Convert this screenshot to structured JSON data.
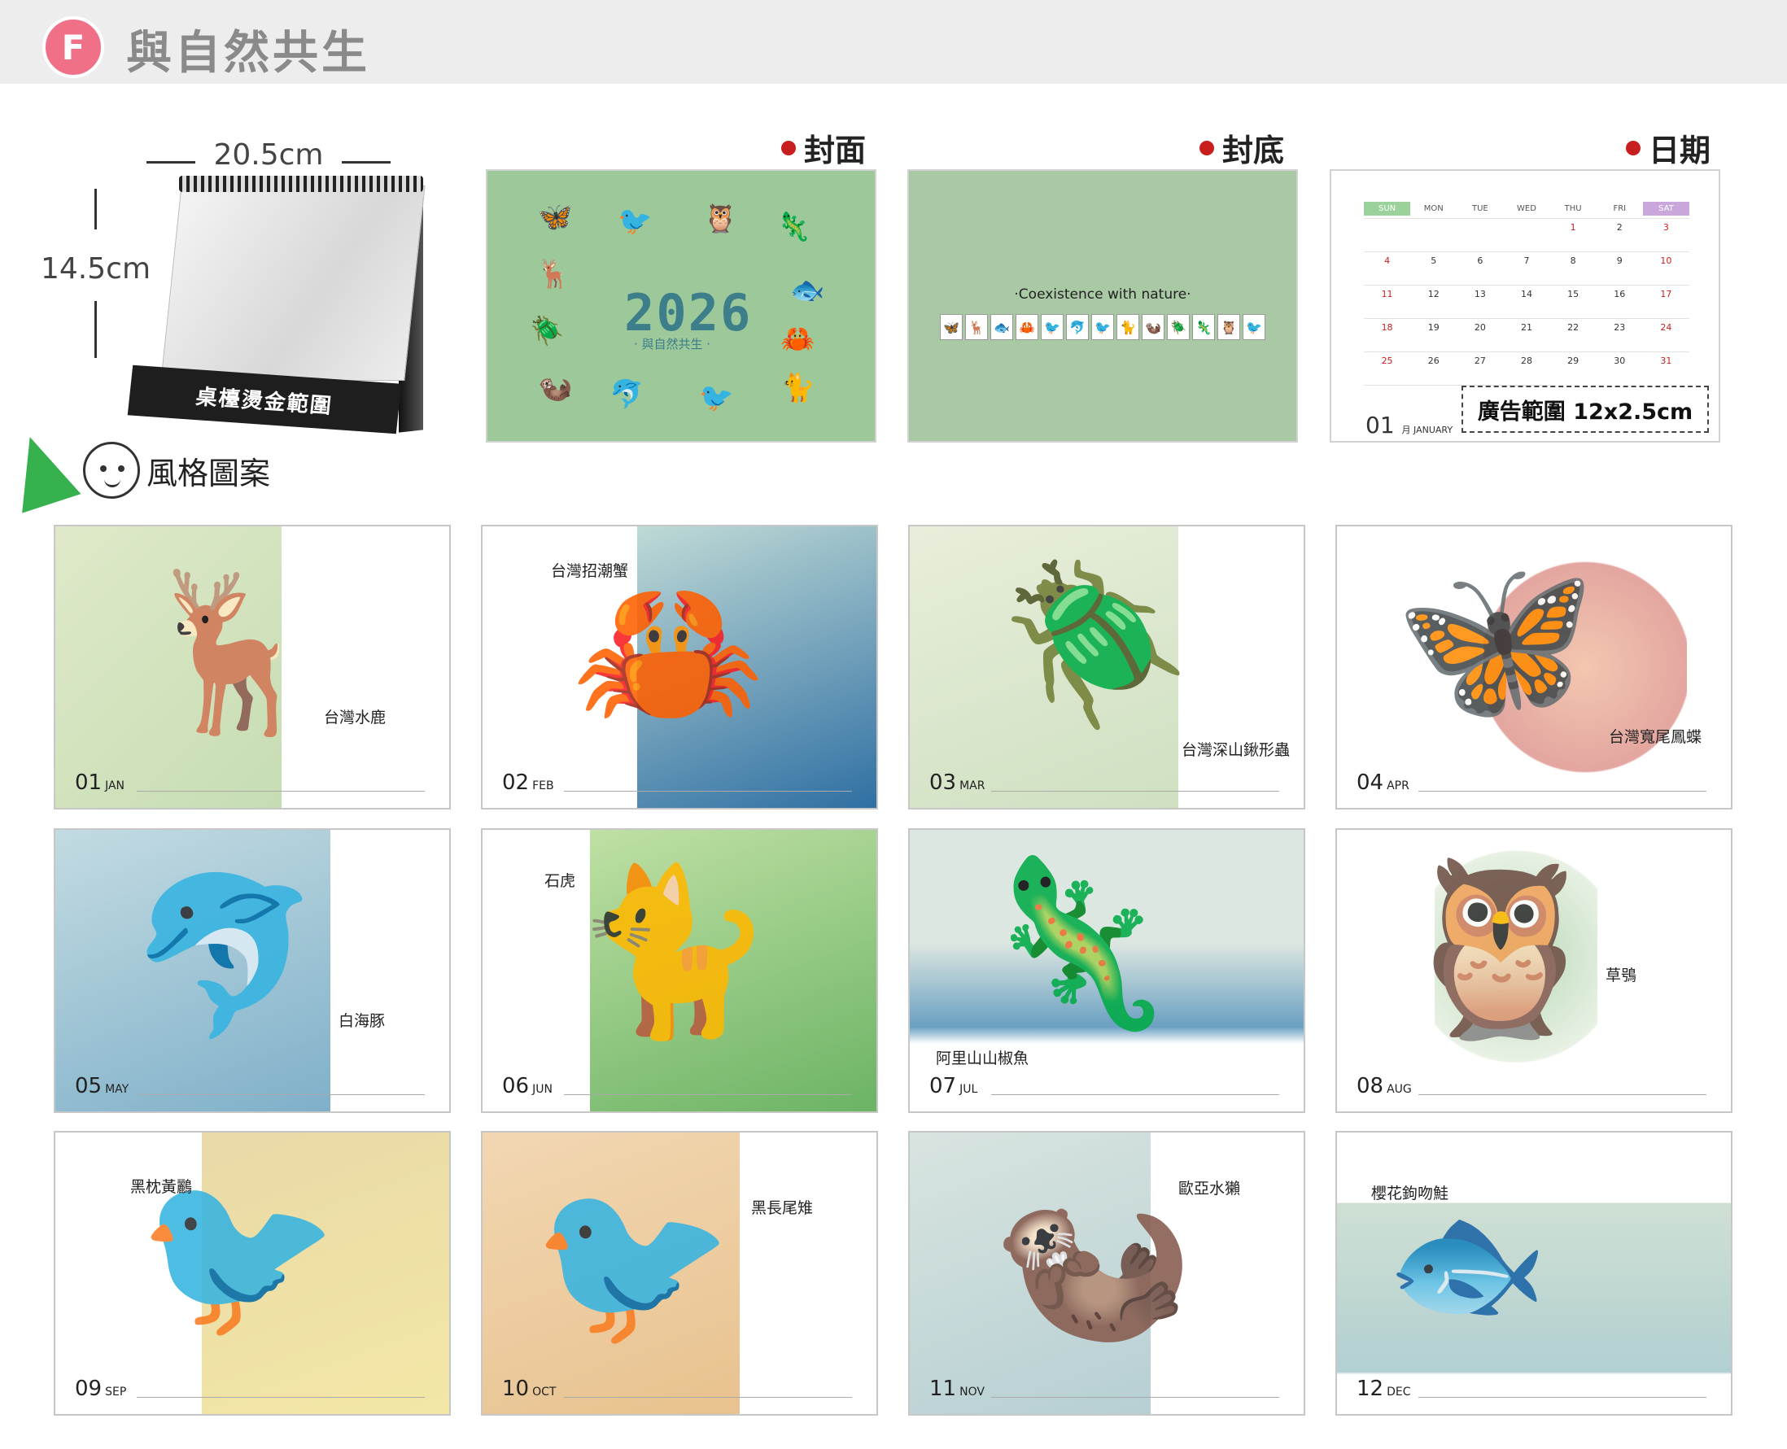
{
  "header": {
    "badge": "F",
    "title": "與自然共生"
  },
  "spec": {
    "width_label": "20.5cm",
    "height_label": "14.5cm",
    "base_label": "桌檯燙金範圍"
  },
  "sections": {
    "front": "封面",
    "back": "封底",
    "date": "日期",
    "style": "風格圖案"
  },
  "front_cover": {
    "year": "2026",
    "subtitle": "· 與自然共生 ·"
  },
  "back_cover": {
    "tagline": "·Coexistence with nature·"
  },
  "date_page": {
    "weekdays": [
      "SUN",
      "MON",
      "TUE",
      "WED",
      "THU",
      "FRI",
      "SAT"
    ],
    "days": [
      "",
      "",
      "",
      "",
      "1",
      "2",
      "3",
      "4",
      "5",
      "6",
      "7",
      "8",
      "9",
      "10",
      "11",
      "12",
      "13",
      "14",
      "15",
      "16",
      "17",
      "18",
      "19",
      "20",
      "21",
      "22",
      "23",
      "24",
      "25",
      "26",
      "27",
      "28",
      "29",
      "30",
      "31",
      "",
      "",
      "",
      ""
    ],
    "holidays": [
      "1",
      "3",
      "4",
      "10",
      "11",
      "17",
      "18",
      "24",
      "25",
      "31"
    ],
    "ad_label": "廣告範圍 12x2.5cm",
    "month_num": "01",
    "month_name": "月 JANUARY"
  },
  "colors": {
    "badge": "#f07088",
    "dot": "#c81e1e",
    "tri": "#36b14e"
  },
  "cards": [
    {
      "num": "01",
      "mon": "JAN",
      "name": "台灣水鹿",
      "icon": "deer-icon"
    },
    {
      "num": "02",
      "mon": "FEB",
      "name": "台灣招潮蟹",
      "icon": "crab-icon"
    },
    {
      "num": "03",
      "mon": "MAR",
      "name": "台灣深山鍬形蟲",
      "icon": "beetle-icon"
    },
    {
      "num": "04",
      "mon": "APR",
      "name": "台灣寬尾鳳蝶",
      "icon": "butterfly-icon"
    },
    {
      "num": "05",
      "mon": "MAY",
      "name": "白海豚",
      "icon": "dolphin-icon"
    },
    {
      "num": "06",
      "mon": "JUN",
      "name": "石虎",
      "icon": "leopard-cat-icon"
    },
    {
      "num": "07",
      "mon": "JUL",
      "name": "阿里山山椒魚",
      "icon": "salamander-icon"
    },
    {
      "num": "08",
      "mon": "AUG",
      "name": "草鴞",
      "icon": "owl-icon"
    },
    {
      "num": "09",
      "mon": "SEP",
      "name": "黑枕黃鸝",
      "icon": "oriole-icon"
    },
    {
      "num": "10",
      "mon": "OCT",
      "name": "黑長尾雉",
      "icon": "pheasant-icon"
    },
    {
      "num": "11",
      "mon": "NOV",
      "name": "歐亞水獺",
      "icon": "otter-icon"
    },
    {
      "num": "12",
      "mon": "DEC",
      "name": "櫻花鉤吻鮭",
      "icon": "salmon-icon"
    }
  ]
}
